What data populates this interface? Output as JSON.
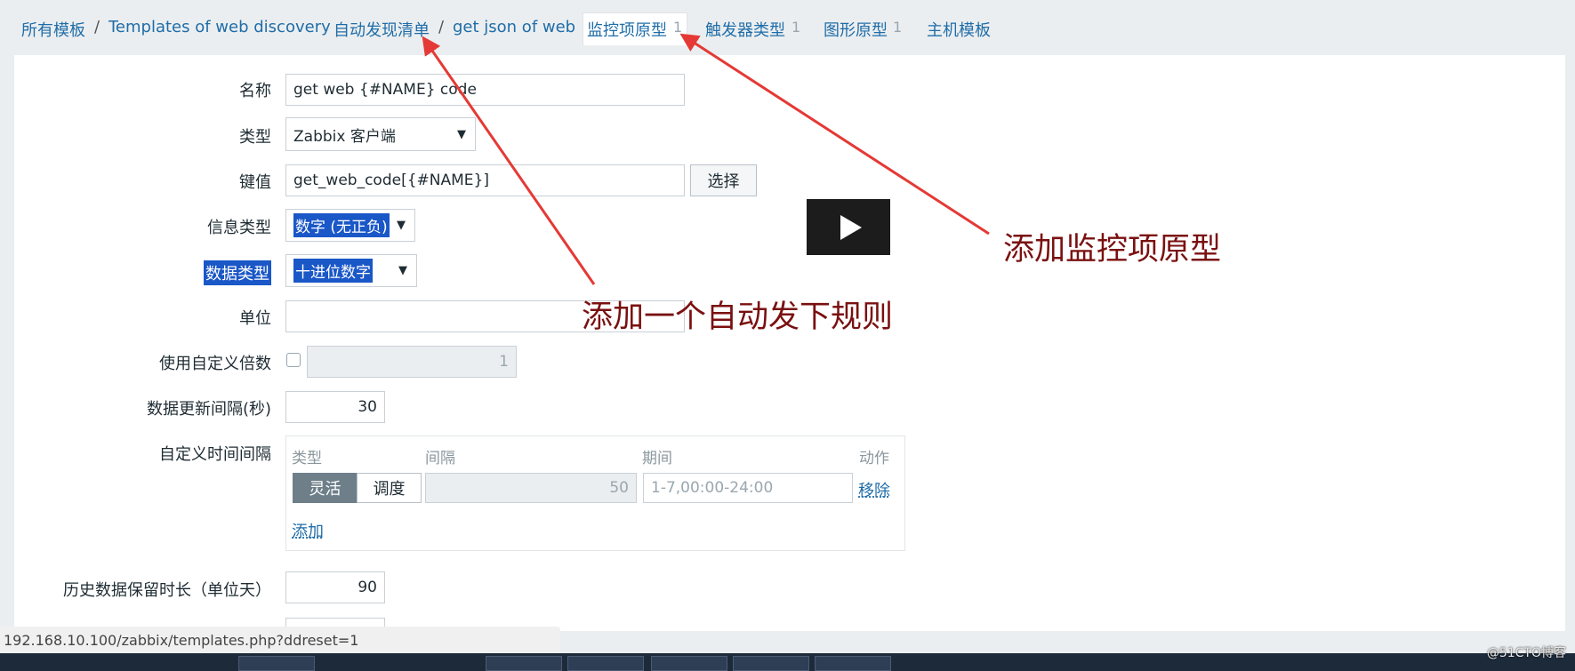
{
  "breadcrumb": {
    "all_templates": "所有模板",
    "template": "Templates of web discovery",
    "discovery_list": "自动发现清单",
    "rule": "get json of web",
    "separator": "/"
  },
  "tabs": [
    {
      "label": "监控项原型",
      "count": "1"
    },
    {
      "label": "触发器类型",
      "count": "1"
    },
    {
      "label": "图形原型",
      "count": "1"
    },
    {
      "label": "主机模板",
      "count": ""
    }
  ],
  "form": {
    "name_label": "名称",
    "name_value": "get web {#NAME} code",
    "type_label": "类型",
    "type_value": "Zabbix 客户端",
    "key_label": "键值",
    "key_value": "get_web_code[{#NAME}]",
    "select_button": "选择",
    "info_type_label": "信息类型",
    "info_type_value": "数字 (无正负)",
    "data_type_label": "数据类型",
    "data_type_value": "十进位数字",
    "units_label": "单位",
    "units_value": "",
    "multiplier_label": "使用自定义倍数",
    "multiplier_value": "1",
    "interval_label": "数据更新间隔(秒)",
    "interval_value": "30",
    "custom_intervals_label": "自定义时间间隔",
    "custom_intervals": {
      "col_type": "类型",
      "col_interval": "间隔",
      "col_period": "期间",
      "col_action": "动作",
      "flexible": "灵活",
      "scheduling": "调度",
      "interval_value": "50",
      "period_placeholder": "1-7,00:00-24:00",
      "remove": "移除",
      "add": "添加"
    },
    "history_label": "历史数据保留时长（单位天）",
    "history_value": "90"
  },
  "annotations": {
    "tab_note": "添加监控项原型",
    "rule_note": "添加一个自动发下规则"
  },
  "status_url": "192.168.10.100/zabbix/templates.php?ddreset=1",
  "watermark": "@51CTO博客",
  "colors": {
    "link": "#1f6da8",
    "annotation_text": "#7a1010",
    "arrow": "#e53935",
    "highlight": "#1a57c7"
  }
}
